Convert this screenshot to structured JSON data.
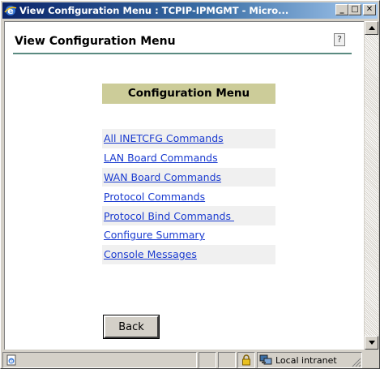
{
  "window": {
    "title": "View Configuration Menu : TCPIP-IPMGMT - Micro...",
    "buttons": {
      "minimize": "_",
      "maximize": "□",
      "close": "✕"
    }
  },
  "page": {
    "title": "View Configuration Menu",
    "help_icon": "?"
  },
  "menu": {
    "heading": "Configuration Menu",
    "items": [
      {
        "label": "All INETCFG Commands"
      },
      {
        "label": "LAN Board Commands"
      },
      {
        "label": "WAN Board Commands"
      },
      {
        "label": "Protocol Commands"
      },
      {
        "label": "Protocol Bind Commands "
      },
      {
        "label": "Configure Summary"
      },
      {
        "label": "Console Messages"
      }
    ]
  },
  "back_button": {
    "label": "Back"
  },
  "statusbar": {
    "zone": "Local intranet"
  },
  "colors": {
    "title_gradient_start": "#0a246a",
    "title_gradient_end": "#a6caf0",
    "heading_bg": "#cccc99",
    "link": "#1a3bd0",
    "header_rule": "#5a8a80"
  }
}
